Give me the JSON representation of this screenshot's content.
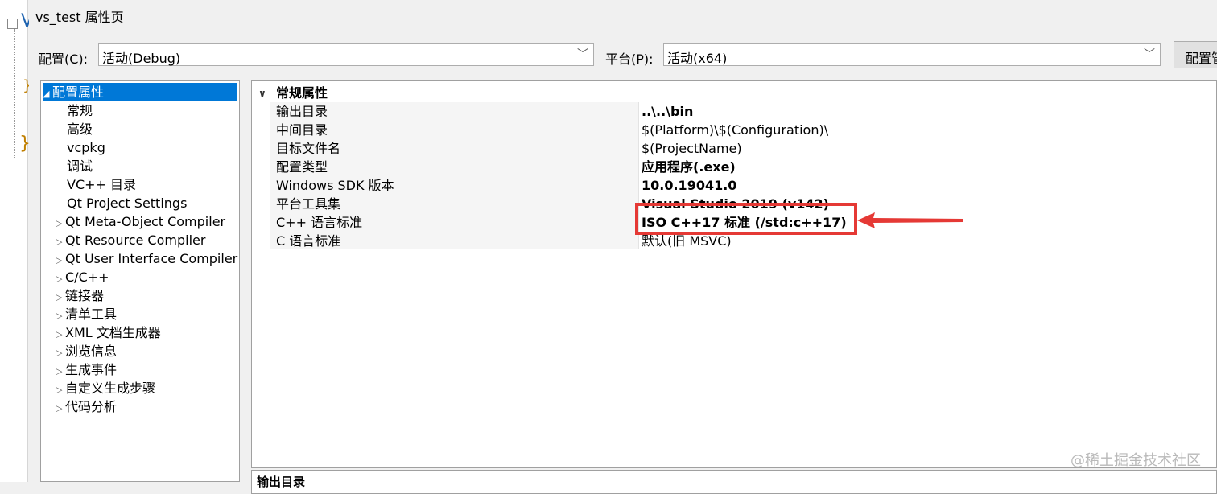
{
  "window": {
    "title": "vs_test 属性页"
  },
  "background_editor": {
    "code_a": "V",
    "code_b": "}",
    "code_c": "}"
  },
  "config_bar": {
    "config_label": "配置(C):",
    "config_value": "活动(Debug)",
    "platform_label": "平台(P):",
    "platform_value": "活动(x64)",
    "manager_button": "配置管理器(O)..."
  },
  "tree": {
    "items": [
      {
        "label": "配置属性",
        "expanded": true,
        "selected": true
      },
      {
        "label": "常规"
      },
      {
        "label": "高级"
      },
      {
        "label": "vcpkg"
      },
      {
        "label": "调试"
      },
      {
        "label": "VC++ 目录"
      },
      {
        "label": "Qt Project Settings"
      },
      {
        "label": "Qt Meta-Object Compiler"
      },
      {
        "label": "Qt Resource Compiler"
      },
      {
        "label": "Qt User Interface Compiler"
      },
      {
        "label": "C/C++"
      },
      {
        "label": "链接器"
      },
      {
        "label": "清单工具"
      },
      {
        "label": "XML 文档生成器"
      },
      {
        "label": "浏览信息"
      },
      {
        "label": "生成事件"
      },
      {
        "label": "自定义生成步骤"
      },
      {
        "label": "代码分析"
      }
    ]
  },
  "grid": {
    "category": "常规属性",
    "properties": [
      {
        "name": "输出目录",
        "value": "..\\..\\bin",
        "bold": true
      },
      {
        "name": "中间目录",
        "value": "$(Platform)\\$(Configuration)\\",
        "bold": false
      },
      {
        "name": "目标文件名",
        "value": "$(ProjectName)",
        "bold": false
      },
      {
        "name": "配置类型",
        "value": "应用程序(.exe)",
        "bold": true
      },
      {
        "name": "Windows SDK 版本",
        "value": "10.0.19041.0",
        "bold": true
      },
      {
        "name": "平台工具集",
        "value": "Visual Studio 2019 (v142)",
        "bold": true
      },
      {
        "name": "C++ 语言标准",
        "value": "ISO C++17 标准 (/std:c++17)",
        "bold": true,
        "highlighted": true
      },
      {
        "name": "C 语言标准",
        "value": "默认(旧 MSVC)",
        "bold": false
      }
    ]
  },
  "description": {
    "title": "输出目录"
  },
  "annotation": {
    "highlight_color": "#e53935"
  },
  "watermark": "@稀土掘金技术社区",
  "colors": {
    "selection": "#0078d7",
    "dialog_bg": "#f0f0f0"
  }
}
